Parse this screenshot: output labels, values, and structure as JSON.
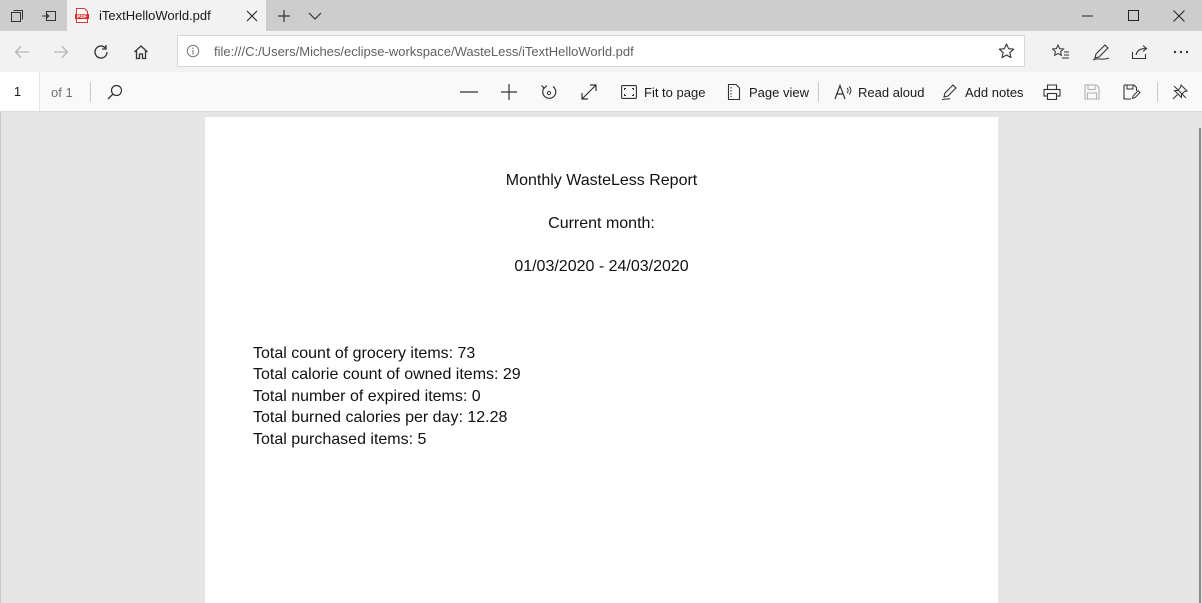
{
  "window": {
    "tab_title": "iTextHelloWorld.pdf"
  },
  "address_bar": {
    "url": "file:///C:/Users/Miches/eclipse-workspace/WasteLess/iTextHelloWorld.pdf"
  },
  "pdf_toolbar": {
    "page_number": "1",
    "page_total": "of 1",
    "fit_to_page_label": "Fit to page",
    "page_view_label": "Page view",
    "read_aloud_label": "Read aloud",
    "add_notes_label": "Add notes"
  },
  "document": {
    "title": "Monthly WasteLess Report",
    "subtitle": "Current month:",
    "date_range": "01/03/2020 - 24/03/2020",
    "stats": [
      "Total count of grocery items: 73",
      "Total calorie count of owned items: 29",
      "Total number of expired items: 0",
      "Total burned calories per day: 12.28",
      "Total purchased items: 5"
    ]
  },
  "icons": {
    "tab_actions": "tab-actions-icon",
    "set_aside_tabs": "set-aside-tabs-icon",
    "pdf_file": "pdf-file-icon",
    "new_tab": "plus-icon",
    "tab_preview": "chevron-down-icon",
    "minimize": "minimize-icon",
    "maximize": "maximize-icon",
    "close": "close-icon",
    "back": "back-arrow-icon",
    "forward": "forward-arrow-icon",
    "refresh": "refresh-icon",
    "home": "home-icon",
    "info": "info-icon",
    "favorite": "star-icon",
    "favorites": "favorites-list-icon",
    "notes": "pen-icon",
    "share": "share-icon",
    "more": "more-icon",
    "search": "search-icon",
    "zoom_out": "zoom-out-icon",
    "zoom_in": "zoom-in-icon",
    "rotate": "rotate-icon",
    "full_screen": "fullscreen-icon",
    "fit_to_page": "fit-to-page-icon",
    "page_view": "page-view-icon",
    "read_aloud": "read-aloud-icon",
    "add_notes": "add-notes-icon",
    "print": "print-icon",
    "save": "save-icon",
    "save_as": "save-as-icon",
    "pin_toolbar": "pin-icon"
  },
  "colors": {
    "tab_strip": "#cdcdcd",
    "active_tab": "#f2f2f2",
    "toolbar": "#f9f9f9",
    "viewer_bg": "#e6e6e6",
    "page": "#ffffff",
    "pdf_badge": "#e02a2a"
  }
}
